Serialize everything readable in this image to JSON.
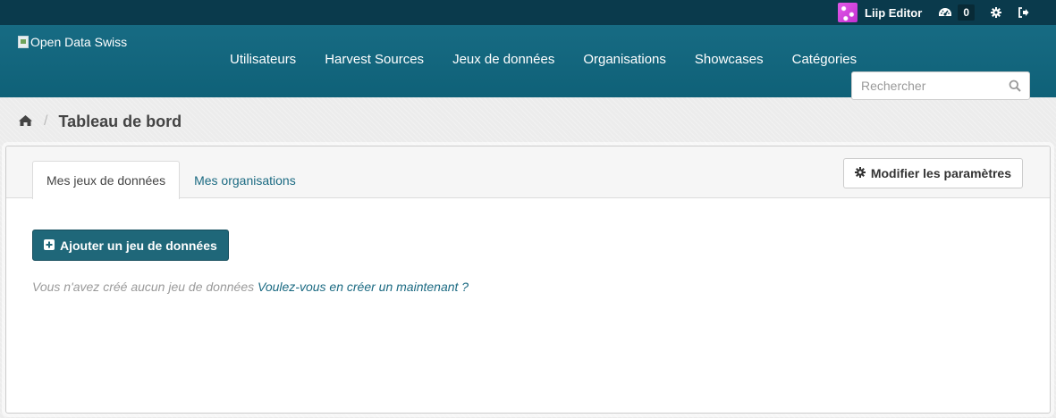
{
  "account": {
    "username": "Liip Editor",
    "activity_count": "0",
    "icons": [
      "avatar",
      "dashboard-icon",
      "gear-icon",
      "sign-out-icon"
    ]
  },
  "masthead": {
    "logo_alt": "Open Data Swiss",
    "nav": [
      {
        "label": "Utilisateurs"
      },
      {
        "label": "Harvest Sources"
      },
      {
        "label": "Jeux de données"
      },
      {
        "label": "Organisations"
      },
      {
        "label": "Showcases"
      },
      {
        "label": "Catégories"
      }
    ],
    "search": {
      "placeholder": "Rechercher",
      "icon": "search-icon"
    }
  },
  "breadcrumb": {
    "home_icon": "home-icon",
    "separator": "/",
    "title": "Tableau de bord"
  },
  "panel": {
    "tabs": [
      {
        "label": "Mes jeux de données",
        "active": true
      },
      {
        "label": "Mes organisations",
        "active": false
      }
    ],
    "settings_button": "Modifier les paramètres",
    "add_button": "Ajouter un jeu de données",
    "empty_text": "Vous n'avez créé aucun jeu de données",
    "empty_link": "Voulez-vous en créer un maintenant ?"
  },
  "colors": {
    "account_bar": "#0a3a4c",
    "masthead": "#176b83",
    "primary_button": "#1f6779",
    "link": "#1b6a82"
  }
}
